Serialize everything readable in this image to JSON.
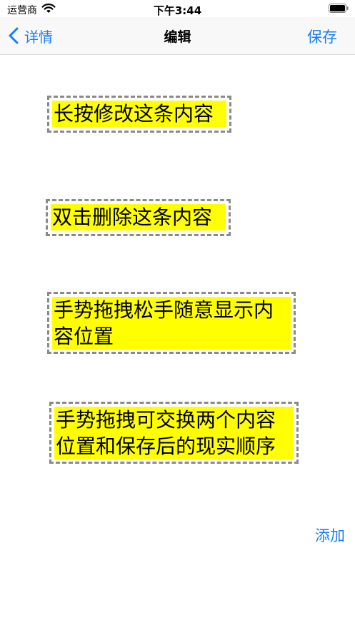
{
  "status_bar": {
    "carrier": "运营商",
    "time": "下午3:44"
  },
  "nav": {
    "back_label": "详情",
    "title": "编辑",
    "save_label": "保存"
  },
  "notes": [
    "长按修改这条内容",
    "双击删除这条内容",
    "手势拖拽松手随意显示内容位置",
    "手势拖拽可交换两个内容位置和保存后的现实顺序"
  ],
  "add_label": "添加",
  "colors": {
    "accent": "#1a7ef2",
    "note_background": "#ffff00",
    "note_border": "#8a8a8a"
  }
}
